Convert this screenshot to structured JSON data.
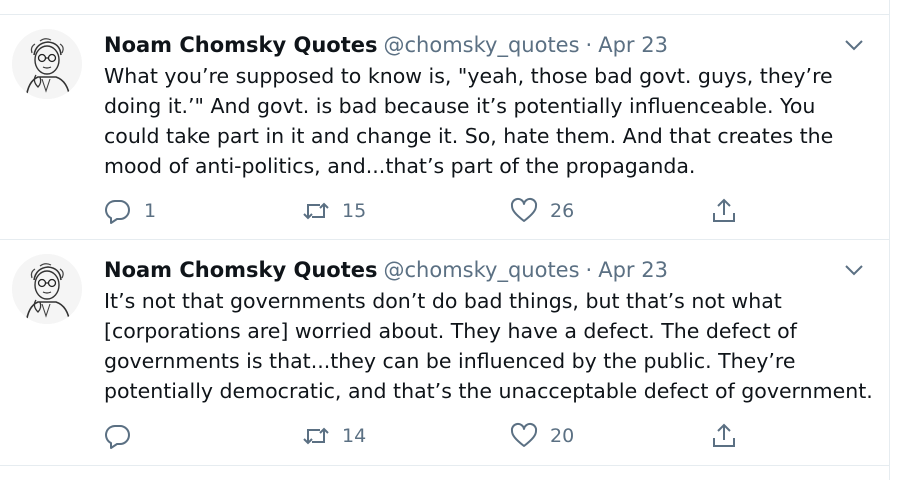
{
  "tweets": [
    {
      "author_name": "Noam Chomsky Quotes",
      "handle": "@chomsky_quotes",
      "separator": "·",
      "date": "Apr 23",
      "text": "What you’re supposed to know is, \"yeah, those bad govt. guys, they’re doing it.’\" And govt. is bad because it’s potentially influenceable. You could take part in it and change it. So, hate them. And that creates the mood of anti-politics, and...that’s part of the propaganda.",
      "replies": "1",
      "retweets": "15",
      "likes": "26"
    },
    {
      "author_name": "Noam Chomsky Quotes",
      "handle": "@chomsky_quotes",
      "separator": "·",
      "date": "Apr 23",
      "text": "It’s not that governments don’t do bad things, but that’s not what [corporations are] worried about. They have a defect. The defect of governments is that...they can be influenced by the public. They’re potentially democratic, and that’s the unacceptable defect of government.",
      "replies": "",
      "retweets": "14",
      "likes": "20"
    }
  ],
  "icons": {
    "reply": "reply-icon",
    "retweet": "retweet-icon",
    "like": "like-icon",
    "share": "share-icon",
    "more": "chevron-down-icon",
    "avatar": "avatar-sketch"
  },
  "colors": {
    "text": "#0f1419",
    "secondary": "#5b7083",
    "border": "#e6ecf0"
  }
}
